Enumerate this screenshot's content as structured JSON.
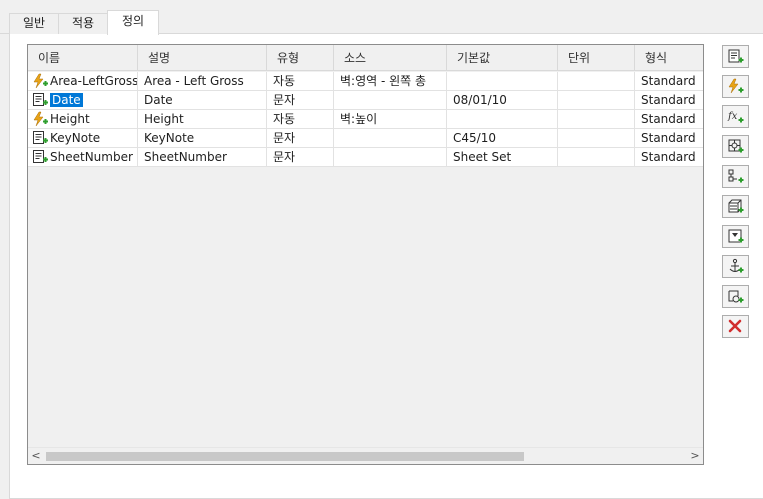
{
  "tabs": [
    {
      "label": "일반",
      "active": false
    },
    {
      "label": "적용",
      "active": false
    },
    {
      "label": "정의",
      "active": true
    }
  ],
  "table": {
    "columns": [
      "이름",
      "설명",
      "유형",
      "소스",
      "기본값",
      "단위",
      "형식"
    ],
    "rows": [
      {
        "icon": "lightning-add-icon",
        "name": "Area-LeftGross",
        "desc": "Area - Left Gross",
        "type": "자동",
        "source": "벽:영역 - 왼쪽 총",
        "default": "",
        "unit": "",
        "format": "Standard",
        "selected": false
      },
      {
        "icon": "text-property-add-icon",
        "name": "Date",
        "desc": "Date",
        "type": "문자",
        "source": "",
        "default": "08/01/10",
        "unit": "",
        "format": "Standard",
        "selected": true
      },
      {
        "icon": "lightning-add-icon",
        "name": "Height",
        "desc": "Height",
        "type": "자동",
        "source": "벽:높이",
        "default": "",
        "unit": "",
        "format": "Standard",
        "selected": false
      },
      {
        "icon": "text-property-add-icon",
        "name": "KeyNote",
        "desc": "KeyNote",
        "type": "문자",
        "source": "",
        "default": "C45/10",
        "unit": "",
        "format": "Standard",
        "selected": false
      },
      {
        "icon": "text-property-add-icon",
        "name": "SheetNumber",
        "desc": "SheetNumber",
        "type": "문자",
        "source": "",
        "default": "Sheet Set",
        "unit": "",
        "format": "Standard",
        "selected": false
      }
    ]
  },
  "scrollbar": {
    "left_arrow": "<",
    "right_arrow": ">"
  },
  "toolbar": [
    "add-text-property-icon",
    "add-automatic-property-icon",
    "add-formula-property-icon",
    "add-location-property-icon",
    "add-classification-property-icon",
    "add-material-property-icon",
    "add-graphic-property-icon",
    "add-anchor-property-icon",
    "add-hyperlink-property-icon",
    "delete-property-icon"
  ],
  "colors": {
    "selection": "#0078d7",
    "add_green": "#2e9e2e",
    "lightning": "#e8a317",
    "delete_red": "#d12d2d"
  }
}
